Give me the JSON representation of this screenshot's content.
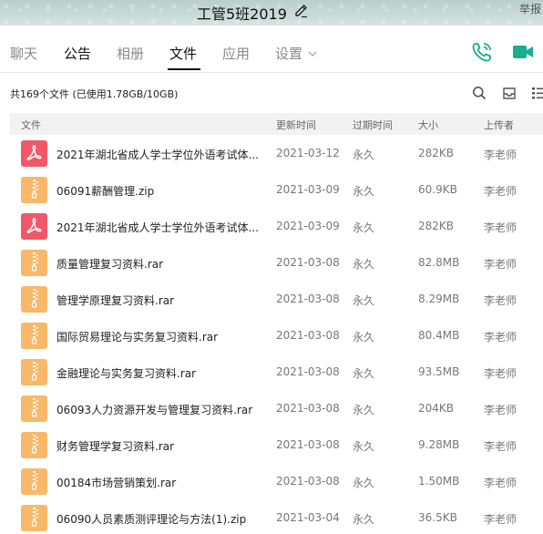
{
  "window": {
    "group_name": "工管5班2019",
    "report_label": "举报"
  },
  "tabs": [
    {
      "label": "聊天"
    },
    {
      "label": "公告"
    },
    {
      "label": "相册"
    },
    {
      "label": "文件"
    },
    {
      "label": "应用"
    },
    {
      "label": "设置"
    }
  ],
  "active_tab": "文件",
  "colors": {
    "call_icon": "#1aad8f",
    "video_icon": "#1aad8f",
    "pdf_icon": "#f0586a",
    "archive_icon": "#f8b86a"
  },
  "summary": "共169个文件 (已使用1.78GB/10GB)",
  "columns": {
    "file": "文件",
    "updated": "更新时间",
    "expires": "过期时间",
    "size": "大小",
    "uploader": "上传者"
  },
  "files": [
    {
      "type": "pdf",
      "name": "2021年湖北省成人学士学位外语考试体...",
      "updated": "2021-03-12",
      "expires": "永久",
      "size": "282KB",
      "uploader": "李老师"
    },
    {
      "type": "zip",
      "name": "06091薪酬管理.zip",
      "updated": "2021-03-09",
      "expires": "永久",
      "size": "60.9KB",
      "uploader": "李老师"
    },
    {
      "type": "pdf",
      "name": "2021年湖北省成人学士学位外语考试体...",
      "updated": "2021-03-09",
      "expires": "永久",
      "size": "282KB",
      "uploader": "李老师"
    },
    {
      "type": "zip",
      "name": "质量管理复习资料.rar",
      "updated": "2021-03-08",
      "expires": "永久",
      "size": "82.8MB",
      "uploader": "李老师"
    },
    {
      "type": "zip",
      "name": "管理学原理复习资料.rar",
      "updated": "2021-03-08",
      "expires": "永久",
      "size": "8.29MB",
      "uploader": "李老师"
    },
    {
      "type": "zip",
      "name": "国际贸易理论与实务复习资料.rar",
      "updated": "2021-03-08",
      "expires": "永久",
      "size": "80.4MB",
      "uploader": "李老师"
    },
    {
      "type": "zip",
      "name": "金融理论与实务复习资料.rar",
      "updated": "2021-03-08",
      "expires": "永久",
      "size": "93.5MB",
      "uploader": "李老师"
    },
    {
      "type": "zip",
      "name": "06093人力资源开发与管理复习资料.rar",
      "updated": "2021-03-08",
      "expires": "永久",
      "size": "204KB",
      "uploader": "李老师"
    },
    {
      "type": "zip",
      "name": "财务管理学复习资料.rar",
      "updated": "2021-03-08",
      "expires": "永久",
      "size": "9.28MB",
      "uploader": "李老师"
    },
    {
      "type": "zip",
      "name": "00184市场营销策划.rar",
      "updated": "2021-03-08",
      "expires": "永久",
      "size": "1.50MB",
      "uploader": "李老师"
    },
    {
      "type": "zip",
      "name": "06090人员素质测评理论与方法(1).zip",
      "updated": "2021-03-04",
      "expires": "永久",
      "size": "36.5KB",
      "uploader": "李老师"
    }
  ]
}
